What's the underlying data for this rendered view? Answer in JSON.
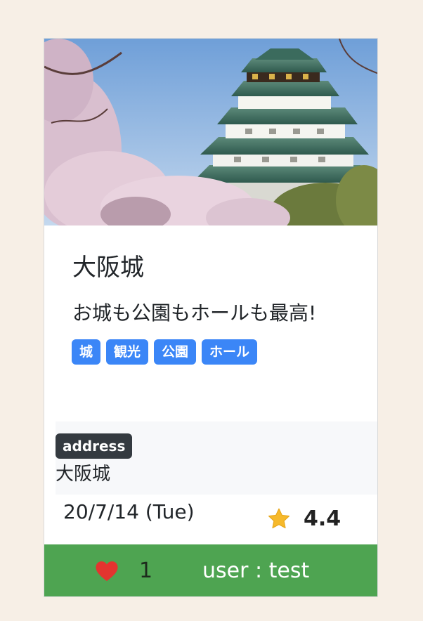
{
  "card": {
    "image": {
      "subject": "osaka-castle-with-cherry-blossoms"
    },
    "title": "大阪城",
    "description": "お城も公園もホールも最高!",
    "tags": [
      "城",
      "観光",
      "公園",
      "ホール"
    ],
    "address": {
      "label": "address",
      "value": "大阪城"
    },
    "date": "20/7/14 (Tue)",
    "rating": {
      "icon": "star-icon",
      "value": "4.4"
    },
    "footer": {
      "like_icon": "heart-icon",
      "like_count": "1",
      "user": "user : test"
    }
  },
  "colors": {
    "page_background": "#f7efe6",
    "tag_blue": "#3b86f7",
    "badge_dark": "#343a40",
    "footer_green": "#4ea451",
    "heart_red": "#e3342f",
    "star_yellow": "#f6b92b"
  }
}
